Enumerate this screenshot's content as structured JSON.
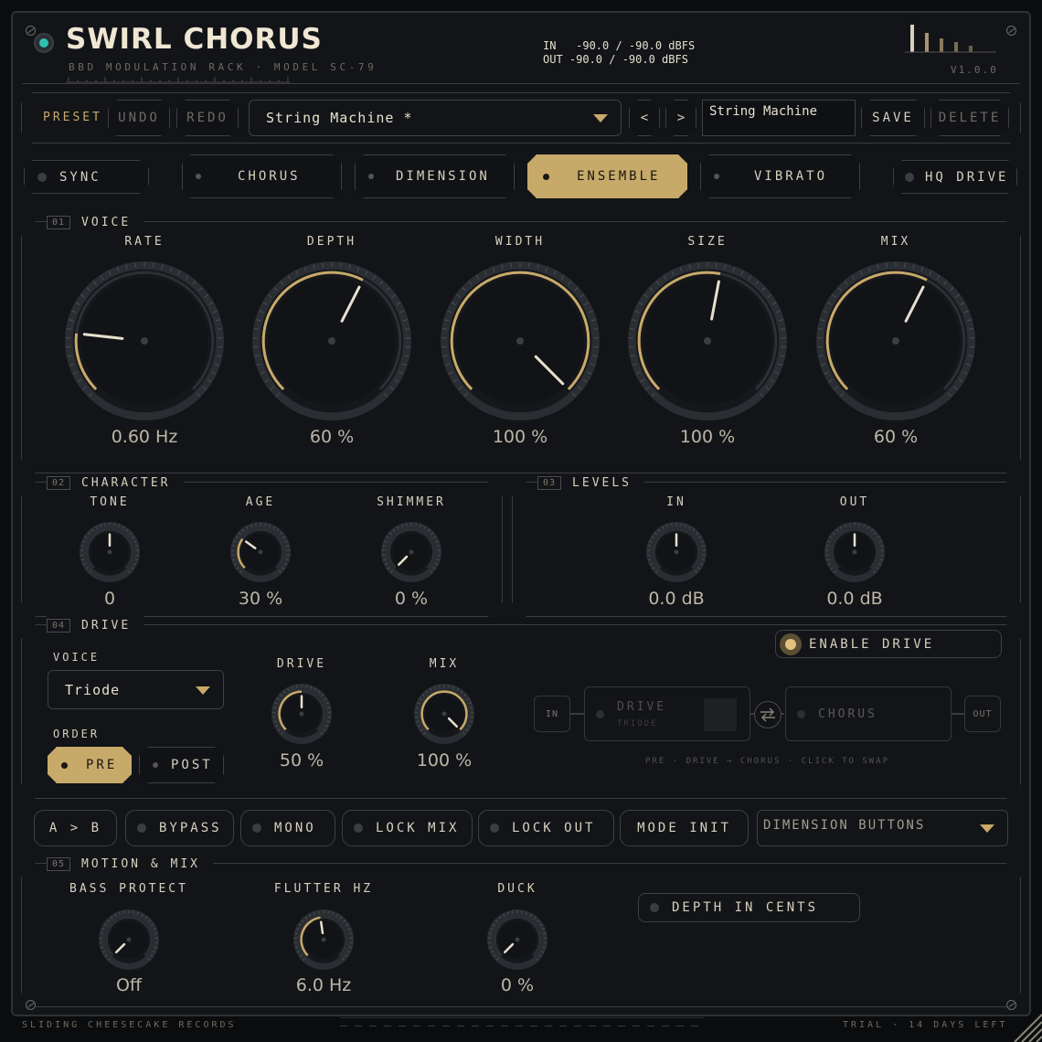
{
  "header": {
    "title": "SWIRL CHORUS",
    "subtitle": "BBD MODULATION RACK · MODEL SC-79",
    "meter_in": "IN   -90.0 / -90.0 dBFS",
    "meter_out": "OUT -90.0 / -90.0 dBFS",
    "version": "V1.0.0"
  },
  "preset": {
    "label": "PRESET",
    "undo": "UNDO",
    "redo": "REDO",
    "current": "String Machine *",
    "prev": "<",
    "next": ">",
    "name_value": "String Machine",
    "save": "SAVE",
    "delete": "DELETE"
  },
  "modes": {
    "sync": "SYNC",
    "items": [
      "CHORUS",
      "DIMENSION",
      "ENSEMBLE",
      "VIBRATO"
    ],
    "active": "ENSEMBLE",
    "hq_drive": "HQ DRIVE"
  },
  "voice": {
    "num": "01",
    "title": "VOICE",
    "knobs": [
      {
        "label": "RATE",
        "value": "0.60 Hz",
        "level": 0.19
      },
      {
        "label": "DEPTH",
        "value": "60 %",
        "level": 0.6
      },
      {
        "label": "WIDTH",
        "value": "100 %",
        "level": 1.0
      },
      {
        "label": "SIZE",
        "value": "100 %",
        "level": 0.54
      },
      {
        "label": "MIX",
        "value": "60 %",
        "level": 0.6
      }
    ]
  },
  "character": {
    "num": "02",
    "title": "CHARACTER",
    "knobs": [
      {
        "label": "TONE",
        "value": "0",
        "level": 0.5
      },
      {
        "label": "AGE",
        "value": "30 %",
        "level": 0.3
      },
      {
        "label": "SHIMMER",
        "value": "0 %",
        "level": 0.0
      }
    ]
  },
  "levels": {
    "num": "03",
    "title": "LEVELS",
    "knobs": [
      {
        "label": "IN",
        "value": "0.0 dB",
        "level": 0.5
      },
      {
        "label": "OUT",
        "value": "0.0 dB",
        "level": 0.5
      }
    ]
  },
  "drive": {
    "num": "04",
    "title": "DRIVE",
    "voice_label": "VOICE",
    "voice_value": "Triode",
    "order_label": "ORDER",
    "pre": "PRE",
    "post": "POST",
    "enable": "ENABLE DRIVE",
    "knobs": [
      {
        "label": "DRIVE",
        "value": "50 %",
        "level": 0.5
      },
      {
        "label": "MIX",
        "value": "100 %",
        "level": 1.0
      }
    ],
    "chain": {
      "in": "IN",
      "drive": "DRIVE",
      "drive_sub": "TRIODE",
      "chorus": "CHORUS",
      "out": "OUT",
      "hint": "PRE · DRIVE → CHORUS · CLICK TO SWAP"
    }
  },
  "toolbar": {
    "ab": "A > B",
    "bypass": "BYPASS",
    "mono": "MONO",
    "lock_mix": "LOCK MIX",
    "lock_out": "LOCK OUT",
    "mode_init": "MODE INIT",
    "dropdown": "DIMENSION BUTTONS"
  },
  "motion": {
    "num": "05",
    "title": "MOTION & MIX",
    "depth_cents": "DEPTH IN CENTS",
    "knobs": [
      {
        "label": "BASS PROTECT",
        "value": "Off",
        "level": 0.0
      },
      {
        "label": "FLUTTER HZ",
        "value": "6.0 Hz",
        "level": 0.47
      },
      {
        "label": "DUCK",
        "value": "0 %",
        "level": 0.0
      }
    ]
  },
  "footer": {
    "left": "SLIDING CHEESECAKE RECORDS",
    "right": "TRIAL · 14 DAYS LEFT"
  }
}
